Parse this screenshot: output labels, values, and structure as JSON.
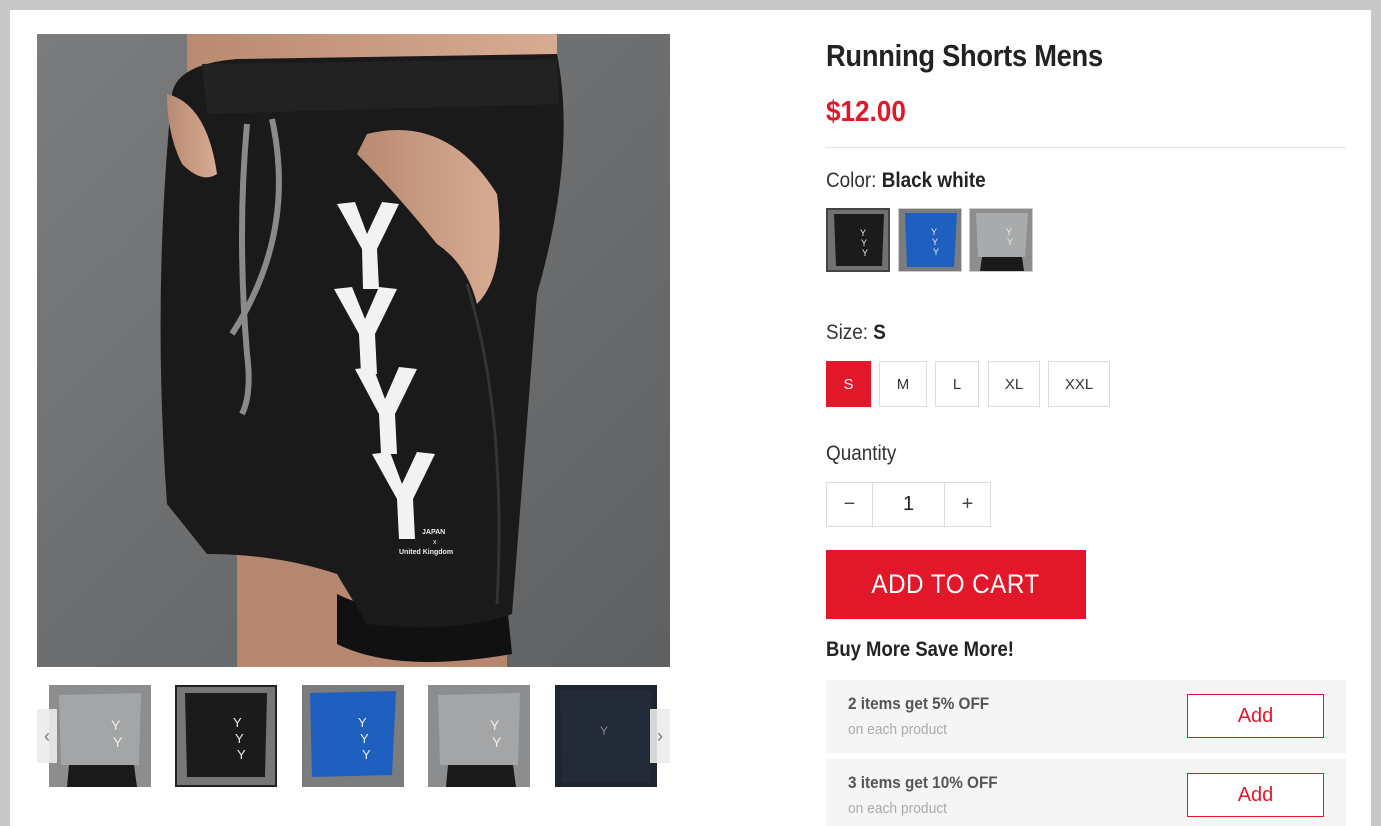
{
  "product": {
    "title": "Running Shorts Mens",
    "price": "$12.00"
  },
  "gallery": {
    "main_image_text": {
      "logo_line1": "JAPAN",
      "logo_line2": "x",
      "logo_line3": "United Kingdom"
    },
    "thumbnails": [
      {
        "alt": "grey shorts",
        "active": false
      },
      {
        "alt": "black shorts",
        "active": true
      },
      {
        "alt": "blue shorts",
        "active": false
      },
      {
        "alt": "grey shorts",
        "active": false
      },
      {
        "alt": "navy shorts",
        "active": false
      }
    ],
    "prev_icon": "chevron-left-icon",
    "next_icon": "chevron-right-icon"
  },
  "color": {
    "label": "Color:",
    "selected": "Black white",
    "swatches": [
      "Black white",
      "Blue",
      "Gray"
    ]
  },
  "size": {
    "label": "Size:",
    "selected": "S",
    "options": [
      "S",
      "M",
      "L",
      "XL",
      "XXL"
    ]
  },
  "quantity": {
    "label": "Quantity",
    "value": "1",
    "minus": "−",
    "plus": "+"
  },
  "cart": {
    "add_label": "ADD TO CART"
  },
  "bulk": {
    "title": "Buy More Save More!",
    "offers": [
      {
        "title": "2 items get 5% OFF",
        "subtitle": "on each product",
        "button": "Add"
      },
      {
        "title": "3 items get 10% OFF",
        "subtitle": "on each product",
        "button": "Add"
      }
    ]
  },
  "colors": {
    "accent": "#e3172a",
    "text": "#222222",
    "offer_bg": "#f5f5f5"
  }
}
